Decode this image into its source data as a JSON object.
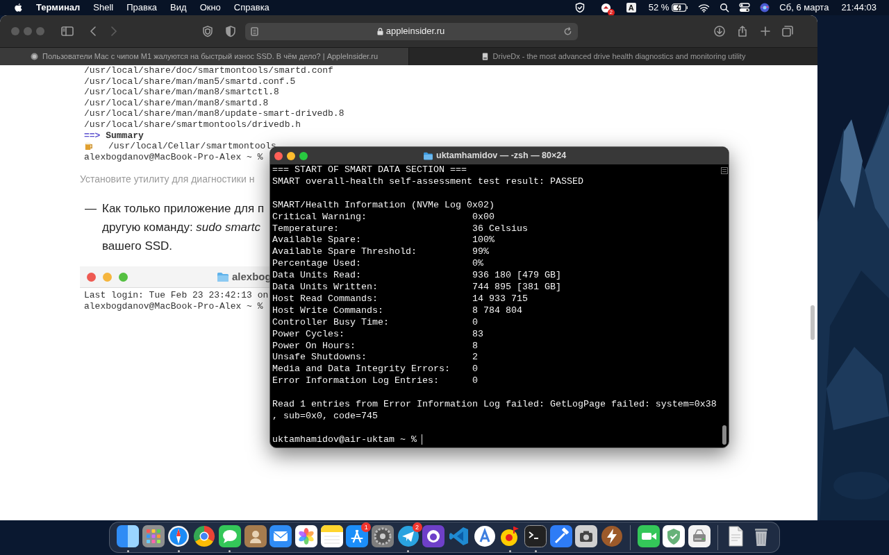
{
  "menu_bar": {
    "app": "Терминал",
    "menus": [
      "Shell",
      "Правка",
      "Вид",
      "Окно",
      "Справка"
    ],
    "notification_badge": "2",
    "input_source": "A",
    "battery": "52 %",
    "date": "Сб, 6 марта",
    "time": "21:44:03"
  },
  "browser": {
    "url": "appleinsider.ru",
    "tabs": [
      {
        "title": "Пользователи Mac с чипом M1 жалуются на быстрый износ SSD. В чём дело? | AppleInsider.ru",
        "selected": true
      },
      {
        "title": "DriveDx - the most advanced drive health diagnostics and monitoring utility",
        "selected": false
      }
    ]
  },
  "article": {
    "code_lines": [
      {
        "kind": "plain",
        "text": "/usr/local/share/doc/smartmontools/smartd.conf"
      },
      {
        "kind": "plain",
        "text": "/usr/local/share/man/man5/smartd.conf.5"
      },
      {
        "kind": "plain",
        "text": "/usr/local/share/man/man8/smartctl.8"
      },
      {
        "kind": "plain",
        "text": "/usr/local/share/man/man8/smartd.8"
      },
      {
        "kind": "plain",
        "text": "/usr/local/share/man/man8/update-smart-drivedb.8"
      },
      {
        "kind": "plain",
        "text": "/usr/local/share/smartmontools/drivedb.h"
      },
      {
        "kind": "heading",
        "arrow": "==>",
        "text": "Summary"
      },
      {
        "kind": "beer",
        "text": "/usr/local/Cellar/smartmontools"
      },
      {
        "kind": "plain",
        "text": "alexbogdanov@MacBook-Pro-Alex ~ %"
      }
    ],
    "caption": "Установите утилиту для диагностики н",
    "list_item": {
      "marker": "—",
      "lines": [
        "Как только приложение для п",
        "другую команду: *sudo smartc*",
        "вашего SSD."
      ]
    },
    "screenshot": {
      "title": "alexbog",
      "lines": [
        "Last login: Tue Feb 23 23:42:13 on",
        "alexbogdanov@MacBook-Pro-Alex ~ %"
      ]
    }
  },
  "terminal": {
    "title": "uktamhamidov — -zsh — 80×24",
    "header_lines": [
      "=== START OF SMART DATA SECTION ===",
      "SMART overall-health self-assessment test result: PASSED"
    ],
    "section_title": "SMART/Health Information (NVMe Log 0x02)",
    "fields": [
      {
        "label": "Critical Warning:",
        "value": "0x00"
      },
      {
        "label": "Temperature:",
        "value": "36 Celsius"
      },
      {
        "label": "Available Spare:",
        "value": "100%"
      },
      {
        "label": "Available Spare Threshold:",
        "value": "99%"
      },
      {
        "label": "Percentage Used:",
        "value": "0%"
      },
      {
        "label": "Data Units Read:",
        "value": "936 180 [479 GB]"
      },
      {
        "label": "Data Units Written:",
        "value": "744 895 [381 GB]"
      },
      {
        "label": "Host Read Commands:",
        "value": "14 933 715"
      },
      {
        "label": "Host Write Commands:",
        "value": "8 784 804"
      },
      {
        "label": "Controller Busy Time:",
        "value": "0"
      },
      {
        "label": "Power Cycles:",
        "value": "83"
      },
      {
        "label": "Power On Hours:",
        "value": "8"
      },
      {
        "label": "Unsafe Shutdowns:",
        "value": "2"
      },
      {
        "label": "Media and Data Integrity Errors:",
        "value": "0"
      },
      {
        "label": "Error Information Log Entries:",
        "value": "0"
      }
    ],
    "error_lines": [
      "Read 1 entries from Error Information Log failed: GetLogPage failed: system=0x38",
      ", sub=0x0, code=745"
    ],
    "prompt": "uktamhamidov@air-uktam ~ %"
  },
  "dock": {
    "sections": [
      {
        "apps": [
          {
            "running": true
          },
          {
            "running": false
          },
          {
            "running": true
          },
          {
            "running": false
          },
          {
            "running": true
          },
          {
            "running": false
          },
          {
            "running": false
          },
          {
            "running": false
          },
          {
            "running": false
          },
          {
            "running": false,
            "badge": "1"
          },
          {
            "running": false
          },
          {
            "running": true,
            "badge": "2"
          },
          {
            "running": false
          },
          {
            "running": false
          },
          {
            "running": false
          },
          {
            "running": true
          },
          {
            "running": true
          },
          {
            "running": false
          },
          {
            "running": false
          },
          {
            "running": false
          }
        ]
      },
      {
        "apps": [
          {
            "running": false
          },
          {
            "running": false
          },
          {
            "running": false
          }
        ]
      },
      {
        "apps": [
          {
            "running": false
          },
          {
            "running": false
          }
        ]
      }
    ]
  }
}
